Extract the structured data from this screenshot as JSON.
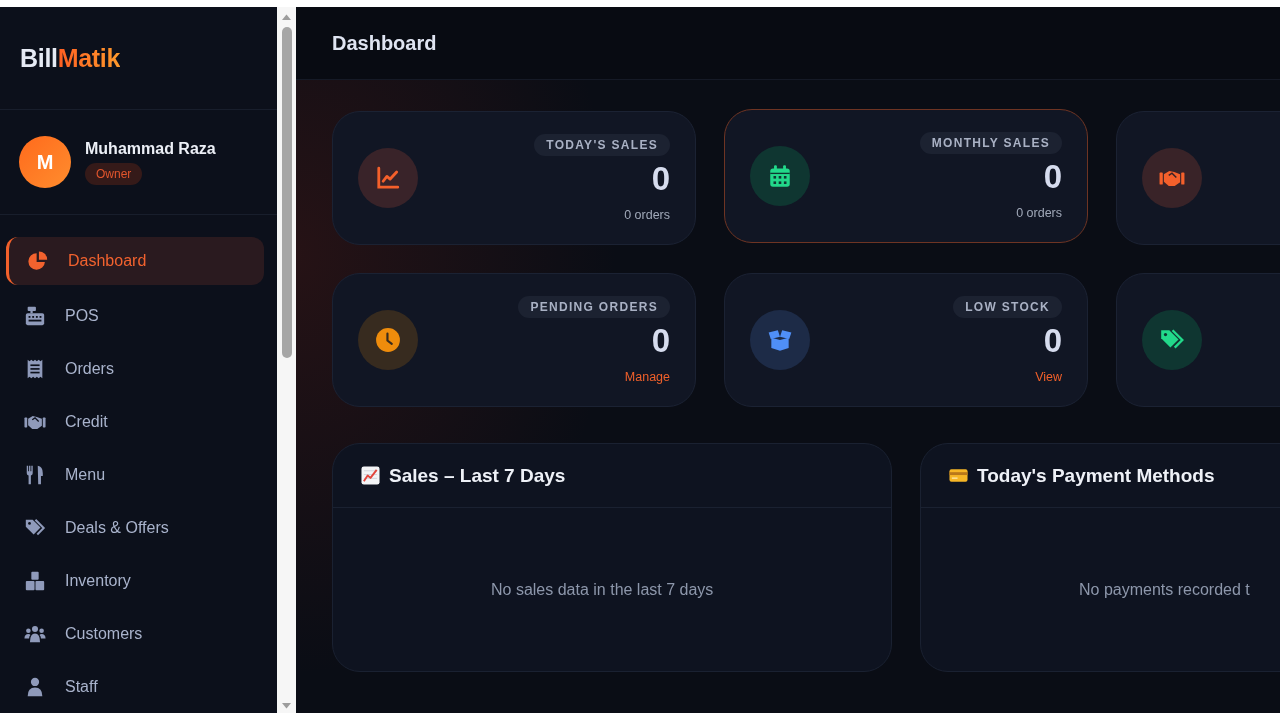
{
  "brand": {
    "logo": [
      {
        "text": "Bill",
        "kind": "plain"
      },
      {
        "text": "Matik",
        "kind": "accent"
      }
    ]
  },
  "user": {
    "initial": "M",
    "name": "Muhammad Raza",
    "role": "Owner"
  },
  "nav": [
    {
      "label": "Dashboard",
      "kind": "pie",
      "selected": true
    },
    {
      "label": "POS",
      "kind": "register",
      "selected": false
    },
    {
      "label": "Orders",
      "kind": "receipt",
      "selected": false
    },
    {
      "label": "Credit",
      "kind": "handshake",
      "selected": false
    },
    {
      "label": "Menu",
      "kind": "utensils",
      "selected": false
    },
    {
      "label": "Deals & Offers",
      "kind": "tags",
      "selected": false
    },
    {
      "label": "Inventory",
      "kind": "boxes",
      "selected": false
    },
    {
      "label": "Customers",
      "kind": "people",
      "selected": false
    },
    {
      "label": "Staff",
      "kind": "person",
      "selected": false
    }
  ],
  "header": {
    "title": "Dashboard"
  },
  "stat_cards": [
    {
      "kind": "sales",
      "label": "TODAY'S SALES",
      "value": "0",
      "note": "0 orders",
      "highlighted": false
    },
    {
      "kind": "monthly",
      "label": "MONTHLY SALES",
      "value": "0",
      "note": "0 orders",
      "highlighted": true
    },
    {
      "kind": "credit",
      "highlighted": false
    },
    {
      "kind": "pending",
      "label": "PENDING ORDERS",
      "value": "0",
      "link": "Manage",
      "highlighted": false
    },
    {
      "kind": "stock",
      "label": "LOW STOCK",
      "value": "0",
      "link": "View",
      "highlighted": false
    },
    {
      "kind": "deals",
      "highlighted": false
    }
  ],
  "panels": [
    {
      "kind": "sales",
      "title": "Sales – Last 7 Days",
      "empty_text": "No sales data in the last 7 days"
    },
    {
      "kind": "payments",
      "title": "Today's Payment Methods",
      "empty_text": "No payments recorded t"
    }
  ]
}
